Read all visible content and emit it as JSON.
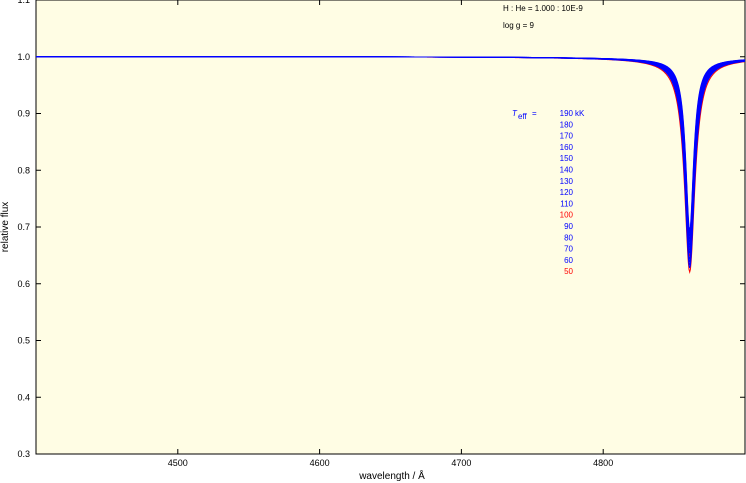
{
  "chart_data": {
    "type": "line",
    "xlabel": "wavelength / Å",
    "ylabel": "relative flux",
    "xlim": [
      4400,
      4900
    ],
    "ylim": [
      0.3,
      1.1
    ],
    "x_ticks": [
      4500,
      4600,
      4700,
      4800
    ],
    "y_ticks": [
      "0.3",
      "0.4",
      "0.5",
      "0.6",
      "0.7",
      "0.8",
      "0.9",
      "1.0",
      "1.1"
    ],
    "annotations": {
      "composition": "H : He = 1.000 : 10E-9",
      "logg": "log g = 9",
      "teff_symbol": "T",
      "teff_sub": "eff",
      "teff_eq": "=",
      "teff_unit": "kK"
    },
    "line_center": 4861,
    "series": [
      {
        "name": "190",
        "color": "#0000ff",
        "min": 0.7,
        "width": 5.0
      },
      {
        "name": "180",
        "color": "#0000ff",
        "min": 0.695,
        "width": 5.1
      },
      {
        "name": "170",
        "color": "#0000ff",
        "min": 0.69,
        "width": 5.2
      },
      {
        "name": "160",
        "color": "#0000ff",
        "min": 0.685,
        "width": 5.3
      },
      {
        "name": "150",
        "color": "#0000ff",
        "min": 0.68,
        "width": 5.4
      },
      {
        "name": "140",
        "color": "#0000ff",
        "min": 0.675,
        "width": 5.5
      },
      {
        "name": "130",
        "color": "#0000ff",
        "min": 0.67,
        "width": 5.6
      },
      {
        "name": "120",
        "color": "#0000ff",
        "min": 0.665,
        "width": 5.7
      },
      {
        "name": "110",
        "color": "#0000ff",
        "min": 0.66,
        "width": 5.8
      },
      {
        "name": "100",
        "color": "#ff0000",
        "min": 0.655,
        "width": 5.9
      },
      {
        "name": "90",
        "color": "#0000ff",
        "min": 0.65,
        "width": 6.0
      },
      {
        "name": "80",
        "color": "#0000ff",
        "min": 0.645,
        "width": 6.1
      },
      {
        "name": "70",
        "color": "#0000ff",
        "min": 0.64,
        "width": 6.2
      },
      {
        "name": "60",
        "color": "#0000ff",
        "min": 0.635,
        "width": 6.3
      },
      {
        "name": "50",
        "color": "#ff0000",
        "min": 0.628,
        "width": 6.6
      }
    ],
    "background": "#fffde4",
    "grid": false
  }
}
